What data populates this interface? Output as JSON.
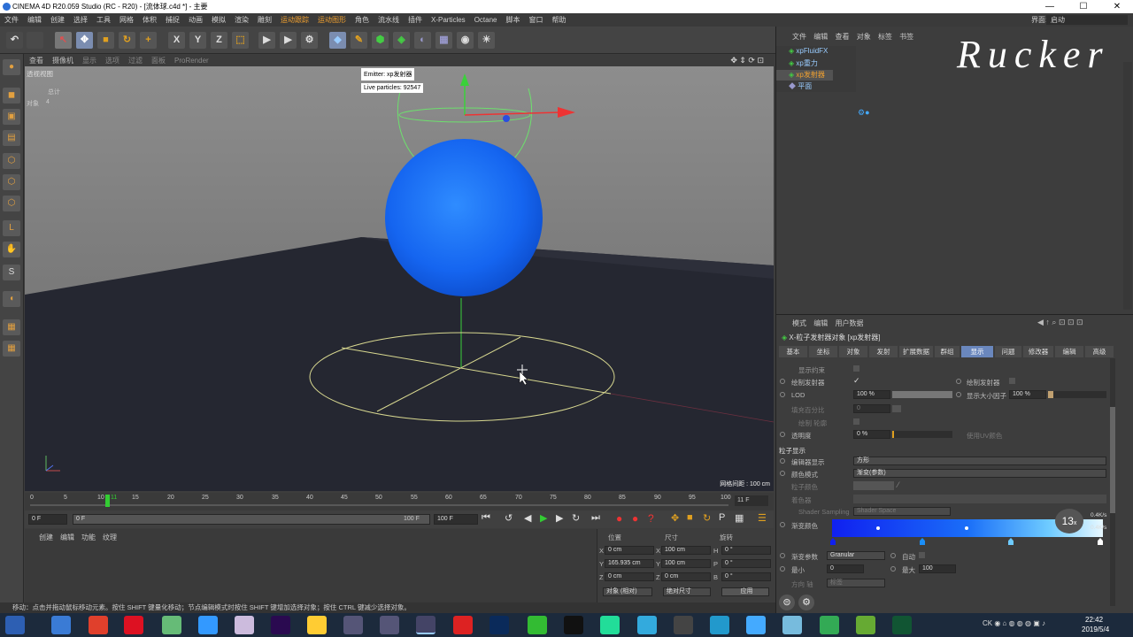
{
  "window": {
    "title": "CINEMA 4D R20.059 Studio (RC - R20) - [流体球.c4d *] - 主要",
    "minimize": "—",
    "maximize": "☐",
    "close": "✕"
  },
  "menu": [
    "文件",
    "编辑",
    "创建",
    "选择",
    "工具",
    "网格",
    "体积",
    "捕捉",
    "动画",
    "模拟",
    "渲染",
    "雕刻",
    "运动跟踪",
    "运动图形",
    "角色",
    "流水线",
    "插件",
    "X-Particles",
    "Octane",
    "脚本",
    "窗口",
    "帮助"
  ],
  "layout_label": "界面:",
  "layout_value": "启动",
  "viewport": {
    "menu": [
      "查看",
      "摄像机",
      "显示",
      "选项",
      "过滤",
      "面板",
      "ProRender"
    ],
    "view_name": "透视视图",
    "stats_label": "总计",
    "objects_label": "对象",
    "objects_count": "4",
    "emitter_label": "Emitter: xp发射器",
    "live_particles": "Live particles: 92547",
    "grid_spacing": "网格间距 : 100 cm"
  },
  "timeline": {
    "ticks": [
      "0",
      "5",
      "10",
      "11",
      "15",
      "20",
      "25",
      "30",
      "35",
      "40",
      "45",
      "50",
      "55",
      "60",
      "65",
      "70",
      "75",
      "80",
      "85",
      "90",
      "95",
      "100"
    ],
    "current_frame": "11 F",
    "start": "0 F",
    "range_start": "0 F",
    "range_end": "100 F",
    "end": "100 F"
  },
  "bottom_tabs": [
    "创建",
    "编辑",
    "功能",
    "纹理"
  ],
  "coords": {
    "headers": [
      "位置",
      "尺寸",
      "旋转"
    ],
    "rows": [
      {
        "axis": "X",
        "pos": "0 cm",
        "size_axis": "X",
        "size": "100 cm",
        "rot_axis": "H",
        "rot": "0 °"
      },
      {
        "axis": "Y",
        "pos": "165.935 cm",
        "size_axis": "Y",
        "size": "100 cm",
        "rot_axis": "P",
        "rot": "0 °"
      },
      {
        "axis": "Z",
        "pos": "0 cm",
        "size_axis": "Z",
        "size": "0 cm",
        "rot_axis": "B",
        "rot": "0 °"
      }
    ],
    "mode": "对象 (相对)",
    "size_mode": "绝对尺寸",
    "apply": "应用"
  },
  "status": "移动：点击并拖动鼠标移动元素。按住 SHIFT 键量化移动；节点编辑模式时按住 SHIFT 键增加选择对象；按住 CTRL 键减少选择对象。",
  "object_manager": {
    "menu": [
      "文件",
      "编辑",
      "查看",
      "对象",
      "标签",
      "书签"
    ],
    "objects": [
      "xpFluidFX",
      "xp重力",
      "xp发射器",
      "平面"
    ]
  },
  "watermark": "Rucker",
  "attributes": {
    "menu": [
      "模式",
      "编辑",
      "用户数据"
    ],
    "object_title": "X-粒子发射器对象 [xp发射器]",
    "tabs": [
      "基本",
      "坐标",
      "对象",
      "发射",
      "扩展数据",
      "群组",
      "显示",
      "问题",
      "修改器",
      "编辑",
      "高级"
    ],
    "active_tab": "显示",
    "show_constraint": "显示约束",
    "draw_emitter": "绘制发射器",
    "draw_emitter_check": "✓",
    "draw_emitter_r": "绘制发射器",
    "lod_label": "LOD",
    "lod_value": "100 %",
    "show_size_label": "显示大小因子",
    "show_size_value": "100 %",
    "fill_label": "填充百分比",
    "fill_value": "0",
    "draw_outline": "绘制 轮廓",
    "opacity_label": "透明度",
    "opacity_value": "0 %",
    "use_uv_color": "使用UV颜色",
    "particle_section": "粒子显示",
    "editor_display_label": "编辑器显示",
    "editor_display_value": "方形",
    "color_mode_label": "颜色模式",
    "color_mode_value": "渐变(参数)",
    "particle_color_label": "粒子颜色",
    "shader_label": "着色器",
    "shader_sampling_label": "Shader Sampling",
    "shader_sampling_value": "Shader Space",
    "gradient_label": "渐变颜色",
    "gradient_param_label": "渐变参数",
    "gradient_param_value": "Granular",
    "auto_label": "自动",
    "min_label": "最小",
    "min_value": "0",
    "max_label": "最大",
    "max_value": "100",
    "direction_label": "方向 轴",
    "direction_value": "标签",
    "speed_badge": "13",
    "speed_badge_unit": "x",
    "net_up": "0.4K/s",
    "net_down": "0.4K/s"
  },
  "tray": {
    "time": "22:42",
    "date": "2019/5/4"
  }
}
